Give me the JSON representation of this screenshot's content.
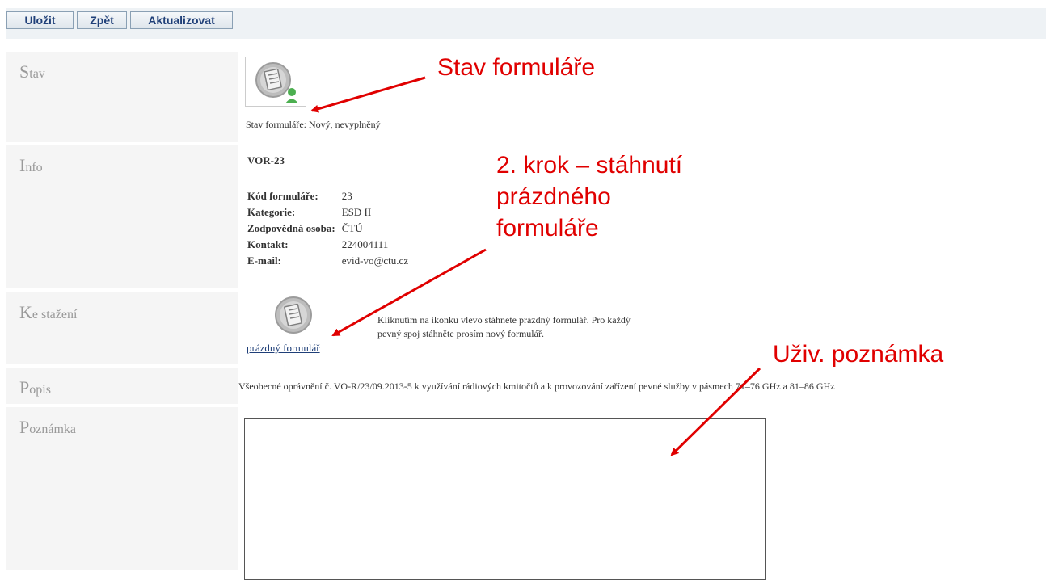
{
  "toolbar": {
    "save_label": "Uložit",
    "back_label": "Zpět",
    "update_label": "Aktualizovat"
  },
  "stav": {
    "label_initial": "S",
    "label_rest": "tav",
    "status_text": "Stav formuláře: Nový, nevyplněný"
  },
  "info": {
    "label_initial": "I",
    "label_rest": "nfo",
    "form_code": "VOR-23",
    "fields": [
      {
        "key": "Kód formuláře:",
        "value": "23"
      },
      {
        "key": "Kategorie:",
        "value": "ESD II"
      },
      {
        "key": "Zodpovědná osoba:",
        "value": "ČTÚ"
      },
      {
        "key": "Kontakt:",
        "value": "224004111"
      },
      {
        "key": "E-mail:",
        "value": "evid-vo@ctu.cz"
      }
    ]
  },
  "download": {
    "label_initial": "K",
    "label_rest": "e stažení",
    "link_text": "prázdný formulář",
    "help_line1": "Kliknutím na ikonku vlevo stáhnete prázdný formulář. Pro každý",
    "help_line2": "pevný spoj stáhněte prosím nový formulář."
  },
  "popis": {
    "label_initial": "P",
    "label_rest": "opis",
    "text": "Všeobecné oprávnění č. VO-R/23/09.2013-5 k využívání rádiových kmitočtů a k provozování zařízení pevné služby v pásmech 71–76 GHz a 81–86 GHz"
  },
  "poznamka": {
    "label_initial": "P",
    "label_rest": "oznámka",
    "value": ""
  },
  "annotations": {
    "stav": "Stav formuláře",
    "krok_line1": "2. krok – stáhnutí",
    "krok_line2": "prázdného",
    "krok_line3": "formuláře",
    "poznamka": "Uživ. poznámka"
  },
  "colors": {
    "annotation": "#e00000",
    "button_text": "#1f3f78",
    "label_gray": "#999999",
    "row_bg": "#f5f5f5"
  },
  "icons": {
    "form_status": "form-user-icon",
    "form_download": "form-document-icon"
  }
}
